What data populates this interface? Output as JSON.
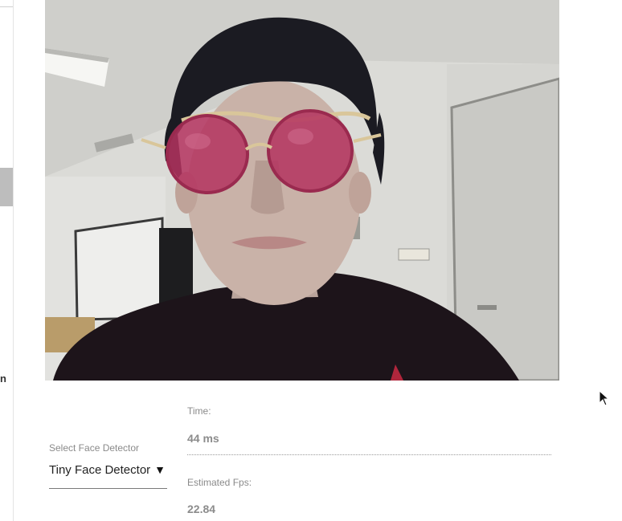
{
  "sidebar": {
    "partial_label": "n"
  },
  "controls": {
    "detector": {
      "label": "Select Face Detector",
      "selected": "Tiny Face Detector",
      "arrow": "▼"
    },
    "time": {
      "label": "Time:",
      "value": "44 ms"
    },
    "fps": {
      "label": "Estimated Fps:",
      "value": "22.84"
    }
  },
  "colors": {
    "lens": "#b4325f",
    "sweater": "#1d141a",
    "wall": "#dcdcd8",
    "ceiling": "#cfcfcb"
  },
  "icons": {
    "cursor": "mouse-pointer-icon",
    "dropdown": "triangle-down-icon"
  }
}
